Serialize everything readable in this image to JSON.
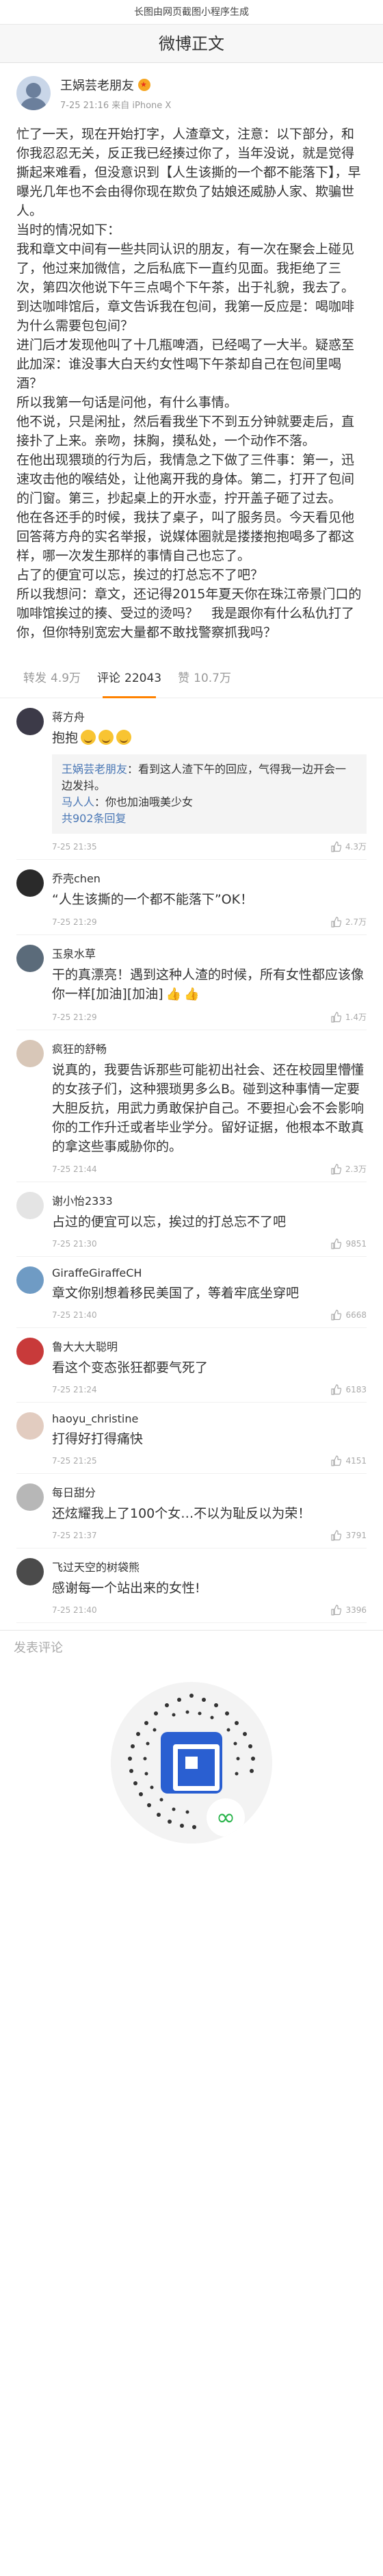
{
  "topbar": {
    "title": "长图由网页截图小程序生成"
  },
  "navbar": {
    "title": "微博正文"
  },
  "post": {
    "author": "王娲芸老朋友",
    "time": "7-25 21:16",
    "source": "来自 iPhone X",
    "paragraphs": [
      "忙了一天，现在开始打字，人渣章文，注意：以下部分，和你我忍忍无关，反正我已经揍过你了，当年没说，就是觉得撕起来难看，但没意识到【人生该撕的一个都不能落下】，早曝光几年也不会由得你现在欺负了姑娘还威胁人家、欺骗世人。",
      "当时的情况如下：",
      "我和章文中间有一些共同认识的朋友，有一次在聚会上碰见了，他过来加微信，之后私底下一直约见面。我拒绝了三次，第四次他说下午三点喝个下午茶，出于礼貌，我去了。",
      "到达咖啡馆后，章文告诉我在包间，我第一反应是：喝咖啡为什么需要包包间？",
      "进门后才发现他叫了十几瓶啤酒，已经喝了一大半。疑惑至此加深：谁没事大白天约女性喝下午茶却自己在包间里喝酒？",
      "所以我第一句话是问他，有什么事情。",
      "他不说，只是闲扯，然后看我坐下不到五分钟就要走后，直接扑了上来。亲吻，抹胸，摸私处，一个动作不落。",
      "在他出现猥琐的行为后，我情急之下做了三件事：第一，迅速攻击他的喉结处，让他离开我的身体。第二，打开了包间的门窗。第三，抄起桌上的开水壶，拧开盖子砸了过去。",
      "他在各还手的时候，我扶了桌子，叫了服务员。今天看见他回答蒋方舟的实名举报，说媒体圈就是搂搂抱抱喝多了都这样，哪一次发生那样的事情自己也忘了。",
      "占了的便宜可以忘，挨过的打总忘不了吧？",
      "所以我想问：章文，还记得2015年夏天你在珠江帝景门口的咖啡馆挨过的揍、受过的烫吗？　我是跟你有什么私仇打了你，但你特别宽宏大量都不敢找警察抓我吗？"
    ]
  },
  "tabs": [
    {
      "label": "转发",
      "count": "4.9万"
    },
    {
      "label": "评论",
      "count": "22043"
    },
    {
      "label": "赞",
      "count": "10.7万"
    }
  ],
  "comments": [
    {
      "name": "蒋方舟",
      "text": "抱抱",
      "time": "7-25 21:35",
      "likes": "4.3万",
      "reply": {
        "lines": [
          {
            "name": "王娲芸老朋友",
            "text": "：看到这人渣下午的回应，气得我一边开会一边发抖。"
          },
          {
            "name": "马人人",
            "text": "：你也加油哦美少女"
          }
        ],
        "more": "共902条回复"
      }
    },
    {
      "name": "乔壳chen",
      "text": "“人生该撕的一个都不能落下”OK！",
      "time": "7-25 21:29",
      "likes": "2.7万"
    },
    {
      "name": "玉泉水草",
      "text": "干的真漂亮！遇到这种人渣的时候，所有女性都应该像你一样[加油][加油]",
      "time": "7-25 21:29",
      "likes": "1.4万"
    },
    {
      "name": "疯狂的舒畅",
      "text": "说真的，我要告诉那些可能初出社会、还在校园里懵懂的女孩子们，这种猥琐男多么B。碰到这种事情一定要大胆反抗，用武力勇敢保护自己。不要担心会不会影响你的工作升迁或者毕业学分。留好证据，他根本不敢真的拿这些事威胁你的。",
      "time": "7-25 21:44",
      "likes": "2.3万"
    },
    {
      "name": "谢小怡2333",
      "text": "占过的便宜可以忘，挨过的打总忘不了吧",
      "time": "7-25 21:30",
      "likes": "9851"
    },
    {
      "name": "GiraffeGiraffeCH",
      "text": "章文你别想着移民美国了，等着牢底坐穿吧",
      "time": "7-25 21:40",
      "likes": "6668"
    },
    {
      "name": "鲁大大大聪明",
      "text": "看这个变态张狂都要气死了",
      "time": "7-25 21:24",
      "likes": "6183"
    },
    {
      "name": "haoyu_christine",
      "text": "打得好打得痛快",
      "time": "7-25 21:25",
      "likes": "4151"
    },
    {
      "name": "每日甜分",
      "text": "还炫耀我上了100个女…不以为耻反以为荣！",
      "time": "7-25 21:37",
      "likes": "3791"
    },
    {
      "name": "飞过天空的树袋熊",
      "text": "感谢每一个站出来的女性!",
      "time": "7-25 21:40",
      "likes": "3396"
    }
  ],
  "comment_bar": {
    "placeholder": "发表评论"
  },
  "colors": {
    "accent": "#ff8200",
    "link": "#4a77b5",
    "qr_blue": "#2a5fd1",
    "qr_green": "#28b34a"
  },
  "icons": {
    "like": "thumbs-up-icon",
    "vip": "vip-badge-icon",
    "miniprogram": "miniprogram-logo-icon"
  }
}
